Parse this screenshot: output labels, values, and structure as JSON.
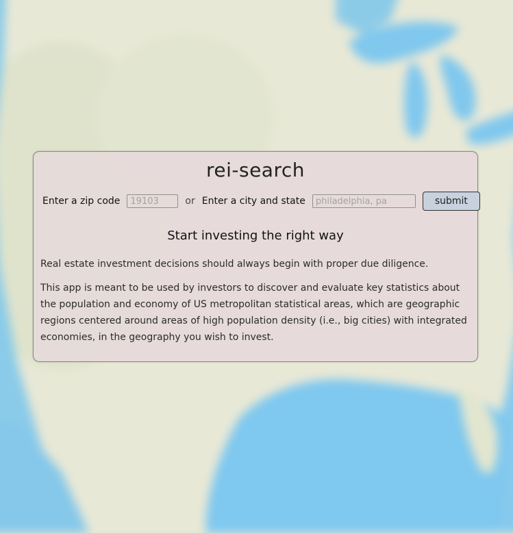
{
  "app": {
    "title": "rei-search"
  },
  "search": {
    "zip_label": "Enter a zip code",
    "zip_placeholder": "19103",
    "or_label": "or",
    "city_label": "Enter a city and state",
    "city_placeholder": "philadelphia, pa",
    "submit_label": "submit"
  },
  "intro": {
    "heading": "Start investing the right way",
    "paragraph1": "Real estate investment decisions should always begin with proper due diligence.",
    "paragraph2": "This app is meant to be used by investors to discover and evaluate key statistics about the population and economy of US metropolitan statistical areas, which are geographic regions centered around areas of high population density (i.e., big cities) with integrated economies, in the geography you wish to invest."
  },
  "colors": {
    "land": "#e8e8d6",
    "water": "#7ec8ee",
    "card_background": "#e5dada",
    "button_background": "#c8d1de"
  }
}
